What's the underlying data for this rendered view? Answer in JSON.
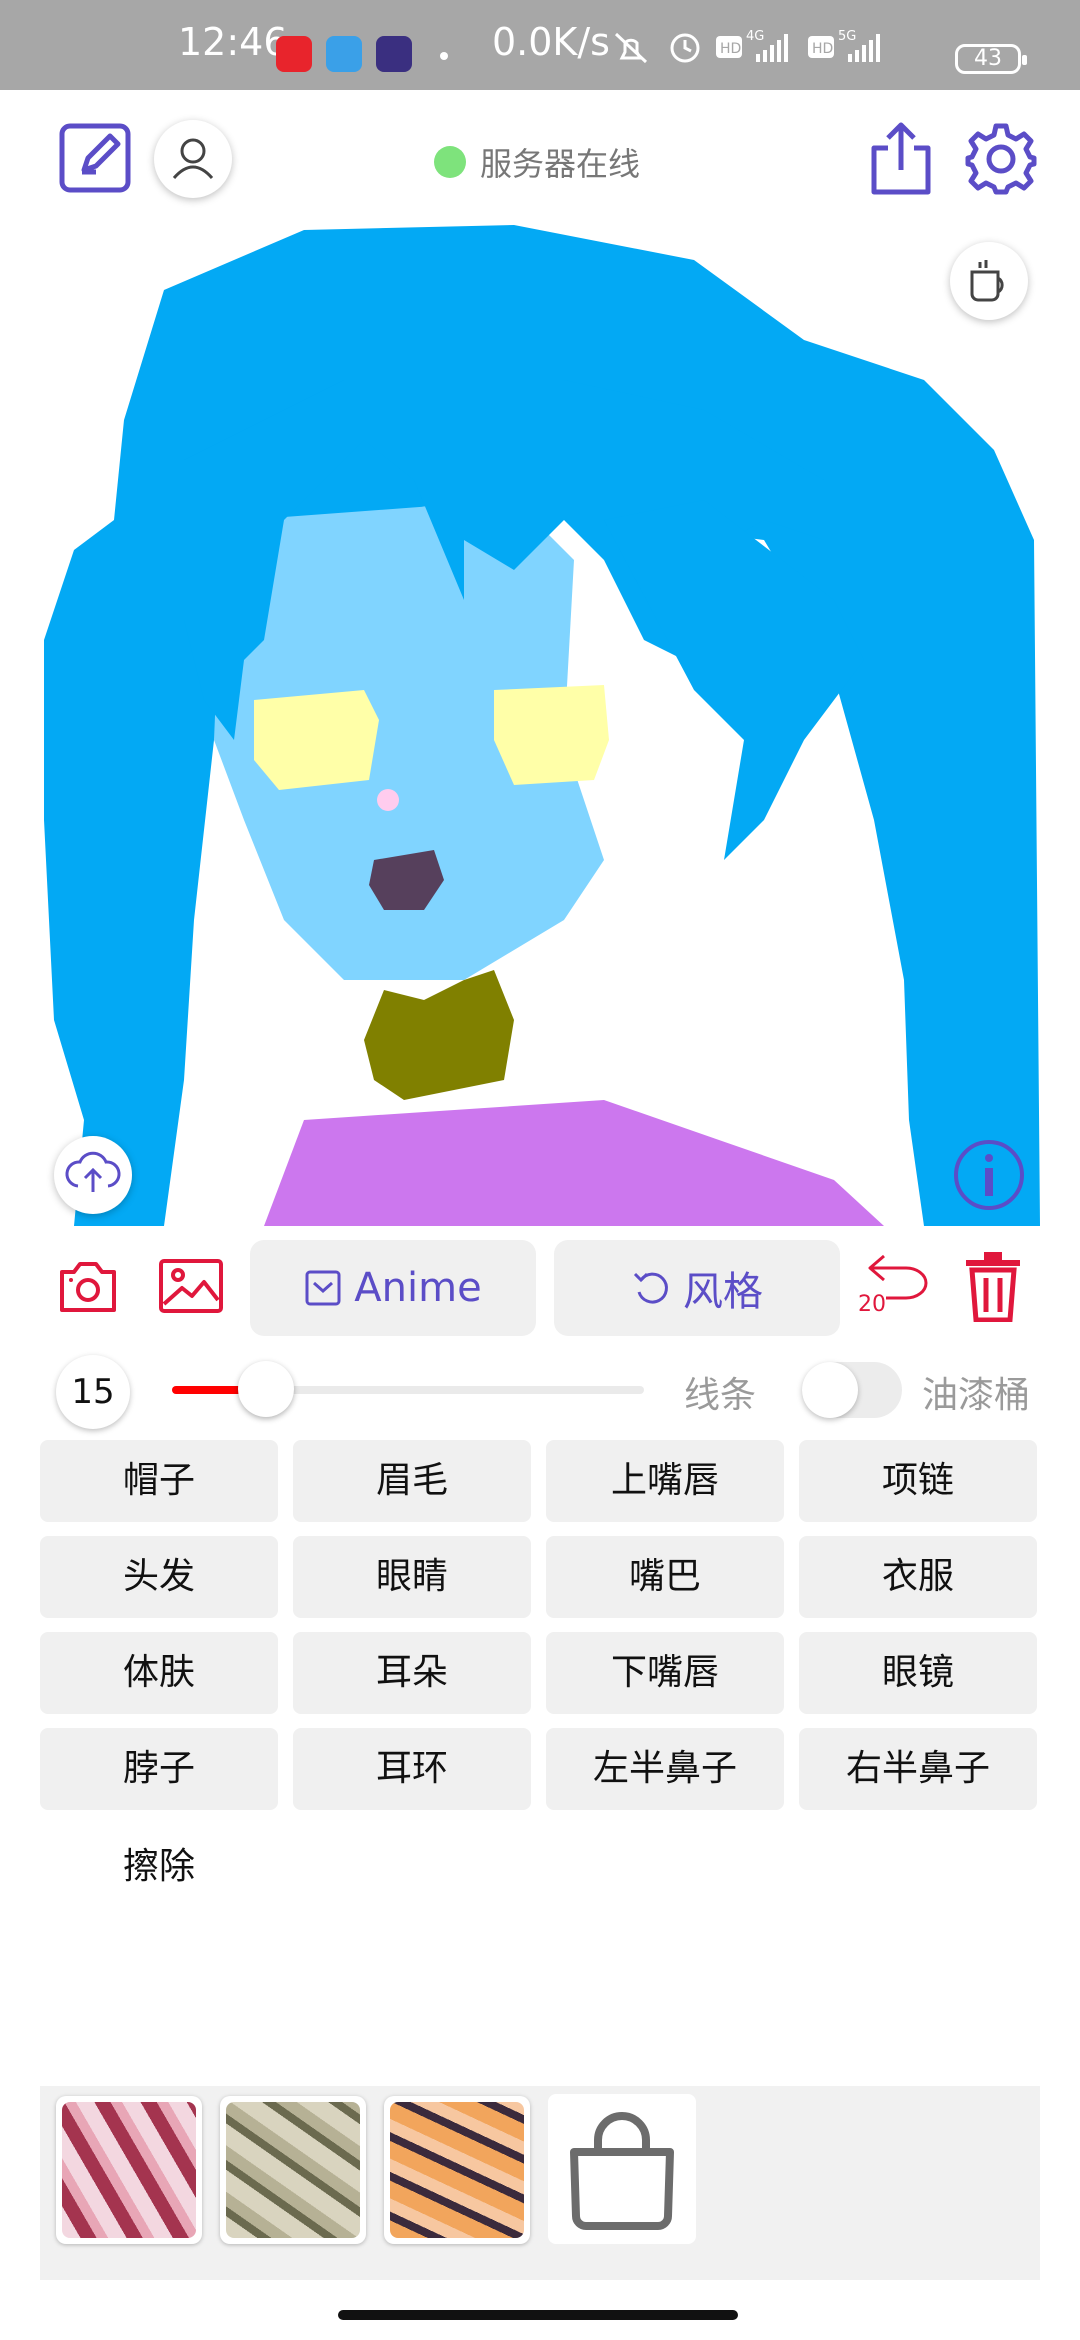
{
  "status_bar": {
    "time": "12:46",
    "network_speed": "0.0K/s",
    "battery": "43",
    "signal_labels": [
      "HD",
      "4G",
      "HD",
      "5G"
    ]
  },
  "header": {
    "server_status": "服务器在线",
    "server_status_color": "#7ee37c"
  },
  "tools": {
    "anime_label": "Anime",
    "style_label": "风格",
    "undo_count": "20",
    "accent_color": "#e0173c",
    "primary_color": "#5b4dc7"
  },
  "brush": {
    "size": "15",
    "slider_fraction": 0.2,
    "lines_label": "线条",
    "bucket_label": "油漆桶",
    "bucket_enabled": false
  },
  "parts": [
    "帽子",
    "眉毛",
    "上嘴唇",
    "项链",
    "头发",
    "眼睛",
    "嘴巴",
    "衣服",
    "体肤",
    "耳朵",
    "下嘴唇",
    "眼镜",
    "脖子",
    "耳环",
    "左半鼻子",
    "右半鼻子"
  ],
  "erase_label": "擦除",
  "styles": [
    {
      "name": "style-1",
      "color_a": "#f3d7e0",
      "color_b": "#a4344f"
    },
    {
      "name": "style-2",
      "color_a": "#d9d4bf",
      "color_b": "#6b6a4f"
    },
    {
      "name": "style-3",
      "color_a": "#f2a55c",
      "color_b": "#3b2a3c"
    }
  ]
}
